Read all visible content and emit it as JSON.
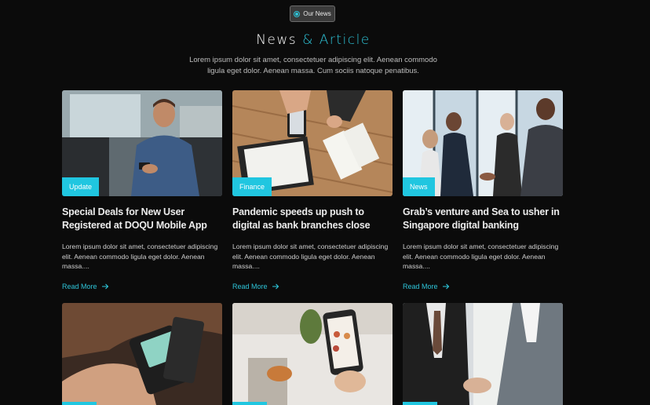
{
  "badge": {
    "label": "Our News",
    "icon": "dot-circle-icon"
  },
  "heading": {
    "main": "News",
    "accent": "& Article"
  },
  "intro": "Lorem ipsum dolor sit amet, consectetuer adipiscing elit. Aenean commodo ligula eget dolor. Aenean massa. Cum sociis natoque penatibus.",
  "colors": {
    "accent": "#2ec4d8",
    "tag": "#20c6e0",
    "background": "#0b0b0b"
  },
  "articles": [
    {
      "tag": "Update",
      "title": "Special Deals for New User Registered at DOQU Mobile App",
      "excerpt": "Lorem ipsum dolor sit amet, consectetuer adipiscing elit. Aenean commodo ligula eget dolor. Aenean massa....",
      "link": "Read More"
    },
    {
      "tag": "Finance",
      "title": "Pandemic speeds up push to digital as bank branches close",
      "excerpt": "Lorem ipsum dolor sit amet, consectetuer adipiscing elit. Aenean commodo ligula eget dolor. Aenean massa....",
      "link": "Read More"
    },
    {
      "tag": "News",
      "title": "Grab’s venture and Sea to usher in Singapore digital banking",
      "excerpt": "Lorem ipsum dolor sit amet, consectetuer adipiscing elit. Aenean commodo ligula eget dolor. Aenean massa....",
      "link": "Read More"
    }
  ]
}
